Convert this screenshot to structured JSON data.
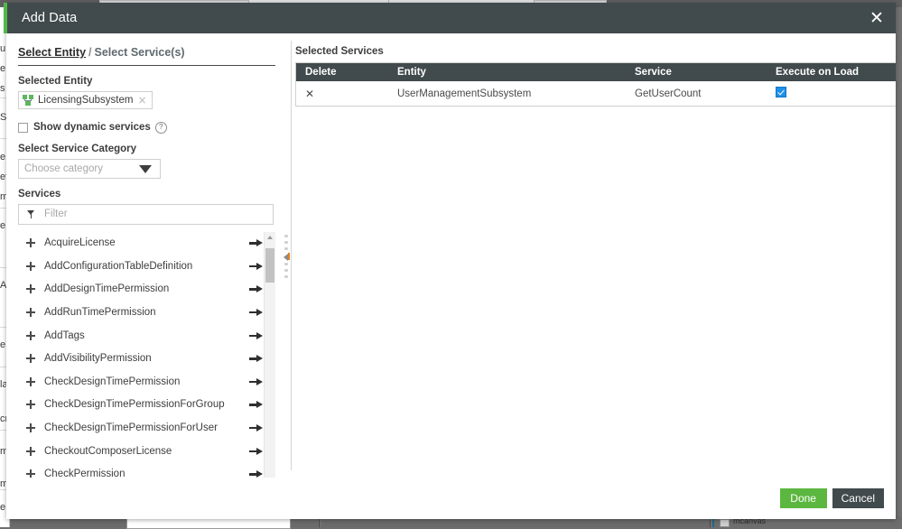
{
  "dialog": {
    "title": "Add Data",
    "close_icon": "close-icon"
  },
  "breadcrumb": {
    "current": "Select Entity",
    "separator": "/",
    "next": "Select Service(s)"
  },
  "left": {
    "selected_entity_label": "Selected Entity",
    "entity_chip": {
      "name": "LicensingSubsystem",
      "remove_icon": "×"
    },
    "show_dynamic_services_label": "Show dynamic services",
    "help_icon": "?",
    "select_service_category_label": "Select Service Category",
    "category_select_value": "Choose category",
    "services_label": "Services",
    "filter_placeholder": "Filter",
    "filter_value": "",
    "services": [
      "AcquireLicense",
      "AddConfigurationTableDefinition",
      "AddDesignTimePermission",
      "AddRunTimePermission",
      "AddTags",
      "AddVisibilityPermission",
      "CheckDesignTimePermission",
      "CheckDesignTimePermissionForGroup",
      "CheckDesignTimePermissionForUser",
      "CheckoutComposerLicense",
      "CheckPermission"
    ]
  },
  "right": {
    "selected_services_label": "Selected Services",
    "columns": [
      "Delete",
      "Entity",
      "Service",
      "Execute on Load"
    ],
    "rows": [
      {
        "delete_icon": "✕",
        "entity": "UserManagementSubsystem",
        "service": "GetUserCount",
        "execute_on_load": true
      }
    ]
  },
  "footer": {
    "done_label": "Done",
    "cancel_label": "Cancel"
  },
  "colors": {
    "titlebar": "#414a4c",
    "accent_green": "#51b848",
    "done_green": "#5cb740",
    "checkbox_blue": "#1e90e8"
  },
  "background": {
    "left_edge_fragments": [
      "u",
      "e",
      "s",
      "S",
      "e",
      "ef",
      "m",
      "e",
      "A",
      "e",
      "la",
      "cr",
      "m",
      "m",
      "e"
    ],
    "bottom_selected_text": "mcanvas"
  }
}
